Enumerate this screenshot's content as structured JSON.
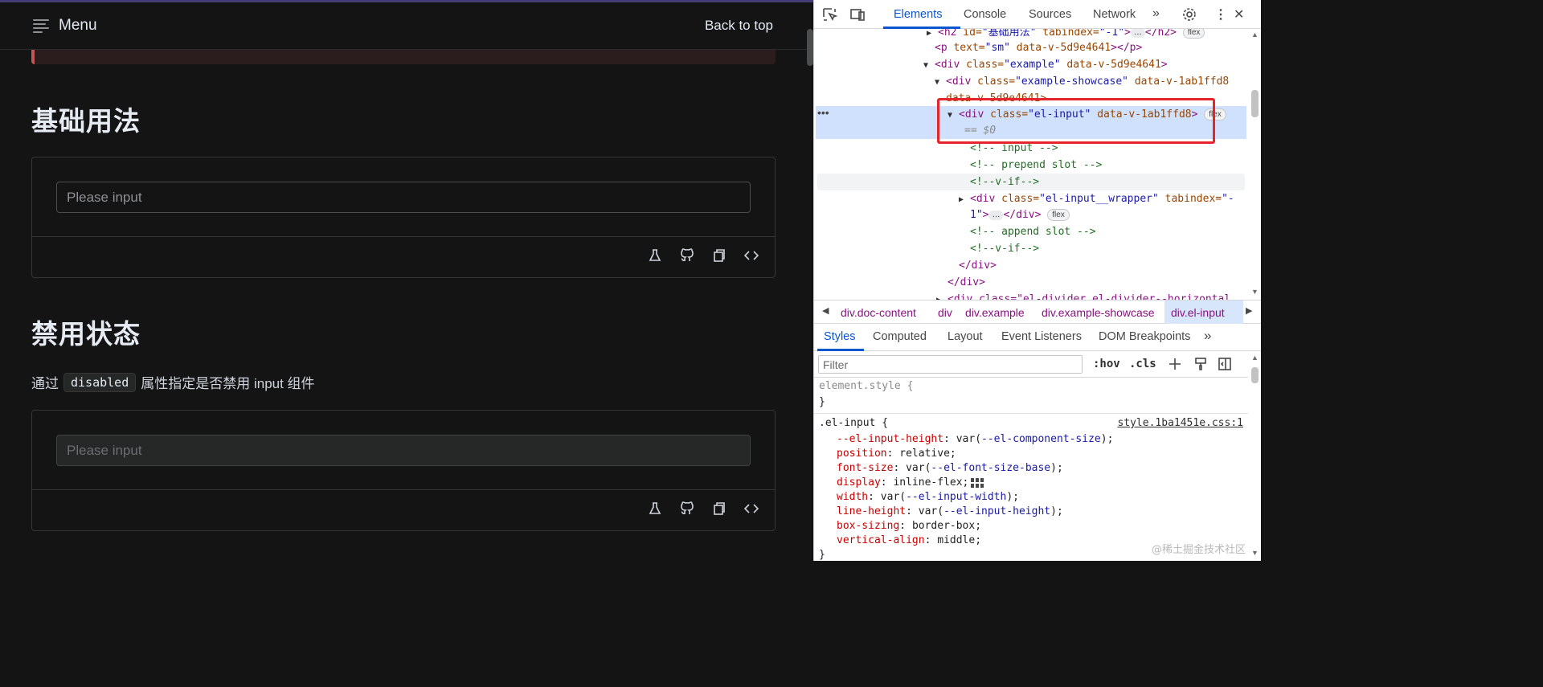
{
  "doc": {
    "menu_label": "Menu",
    "back_to_top": "Back to top",
    "sections": [
      {
        "heading": "基础用法",
        "input_placeholder": "Please input",
        "disabled": false
      },
      {
        "heading": "禁用状态",
        "description_before": "通过",
        "description_code": "disabled",
        "description_after": "属性指定是否禁用 input 组件",
        "input_placeholder": "Please input",
        "disabled": true
      }
    ],
    "example_tools": [
      "playground-icon",
      "github-icon",
      "copy-icon",
      "code-icon"
    ]
  },
  "devtools": {
    "tabs": [
      "Elements",
      "Console",
      "Sources",
      "Network"
    ],
    "active_tab": "Elements",
    "dom": {
      "l0_tag": "<h2",
      "l0_attr": " id=",
      "l0_val": "\"基础用法\"",
      "l0_attr2": " tabindex=",
      "l0_val2": "\"-1\"",
      "l0_end": ">",
      "l0_close": "</h2>",
      "l1_tag": "<p",
      "l1_attr": " text=",
      "l1_val": "\"sm\"",
      "l1_attr2": " data-v-5d9e4641",
      "l1_end": "></p>",
      "l2_tag": "<div",
      "l2_attr": " class=",
      "l2_val": "\"example\"",
      "l2_attr2": " data-v-5d9e4641",
      "l2_end": ">",
      "l3_tag": "<div",
      "l3_attr": " class=",
      "l3_val": "\"example-showcase\"",
      "l3_attr2": " data-v-1ab1ffd8",
      "l3b": "data-v-5d9e4641>",
      "l4_tag": "<div",
      "l4_attr": " class=",
      "l4_val": "\"el-input\"",
      "l4_attr2": " data-v-1ab1ffd8",
      "l4_end": ">",
      "l4_eq": "== $0",
      "c1": "<!-- input -->",
      "c2": "<!-- prepend slot -->",
      "c3": "<!--v-if-->",
      "l8_tag": "<div",
      "l8_attr": " class=",
      "l8_val": "\"el-input__wrapper\"",
      "l8_attr2": " tabindex=",
      "l8_val2": "\"-",
      "l8b_val": "1\"",
      "l8b_end": ">",
      "l8b_close": "</div>",
      "c4": "<!-- append slot -->",
      "c5": "<!--v-if-->",
      "close1": "</div>",
      "close2": "</div>",
      "l13": "<div class=\"el-divider el-divider--horizontal",
      "flex_badge": "flex",
      "ellipsis": "…"
    },
    "breadcrumbs": [
      "div.doc-content",
      "div",
      "div.example",
      "div.example-showcase",
      "div.el-input"
    ],
    "sub_tabs": [
      "Styles",
      "Computed",
      "Layout",
      "Event Listeners",
      "DOM Breakpoints"
    ],
    "filter_placeholder": "Filter",
    "hov": ":hov",
    "cls": ".cls",
    "styles": {
      "element_style": "element.style {",
      "close_brace": "}",
      "rule_selector": ".el-input {",
      "rule_source": "style.1ba1451e.css:1",
      "props": [
        {
          "name": "--el-input-height",
          "pre": "var(",
          "var": "--el-component-size",
          "post": ");"
        },
        {
          "name": "position",
          "value": "relative;"
        },
        {
          "name": "font-size",
          "pre": "var(",
          "var": "--el-font-size-base",
          "post": ");"
        },
        {
          "name": "display",
          "value": "inline-flex;"
        },
        {
          "name": "width",
          "pre": "var(",
          "var": "--el-input-width",
          "post": ");"
        },
        {
          "name": "line-height",
          "pre": "var(",
          "var": "--el-input-height",
          "post": ");"
        },
        {
          "name": "box-sizing",
          "value": "border-box;"
        },
        {
          "name": "vertical-align",
          "value": "middle;"
        }
      ]
    }
  },
  "watermark": "@稀土掘金技术社区",
  "colors": {
    "highlight_box": "#e6242b",
    "accent_blue": "#0b57d0",
    "doc_bg": "#141414"
  }
}
